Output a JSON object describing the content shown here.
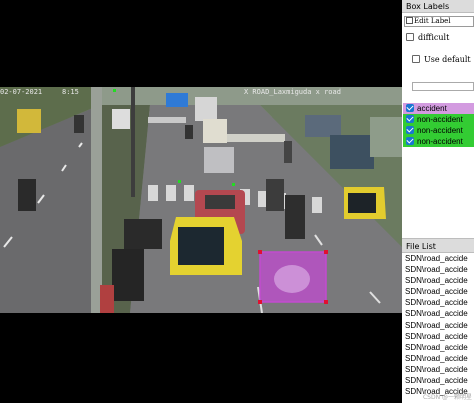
{
  "canvas": {
    "overlay_left": "02-07-2021",
    "overlay_mid": "8:15",
    "overlay_right": "X  ROAD_Laxmiguda  x  road"
  },
  "annotations": [
    {
      "label": "accident",
      "color": "#c24bd0",
      "selected": true
    }
  ],
  "box_labels": {
    "title": "Box Labels",
    "edit_label": "Edit Label",
    "difficult": "difficult",
    "use_default": "Use default",
    "items": [
      {
        "label": "accident",
        "checked": true,
        "bg": "#d39be0"
      },
      {
        "label": "non-accident",
        "checked": true,
        "bg": "#33cc33"
      },
      {
        "label": "non-accident",
        "checked": true,
        "bg": "#33cc33"
      },
      {
        "label": "non-accident",
        "checked": true,
        "bg": "#33cc33"
      }
    ]
  },
  "file_list": {
    "title": "File List",
    "items": [
      "SDN\\road_accide",
      "SDN\\road_accide",
      "SDN\\road_accide",
      "SDN\\road_accide",
      "SDN\\road_accide",
      "SDN\\road_accide",
      "SDN\\road_accide",
      "SDN\\road_accide",
      "SDN\\road_accide",
      "SDN\\road_accide",
      "SDN\\road_accide",
      "SDN\\road_accide",
      "SDN\\road_accide"
    ]
  },
  "watermark": "CSDN @一颗明星"
}
